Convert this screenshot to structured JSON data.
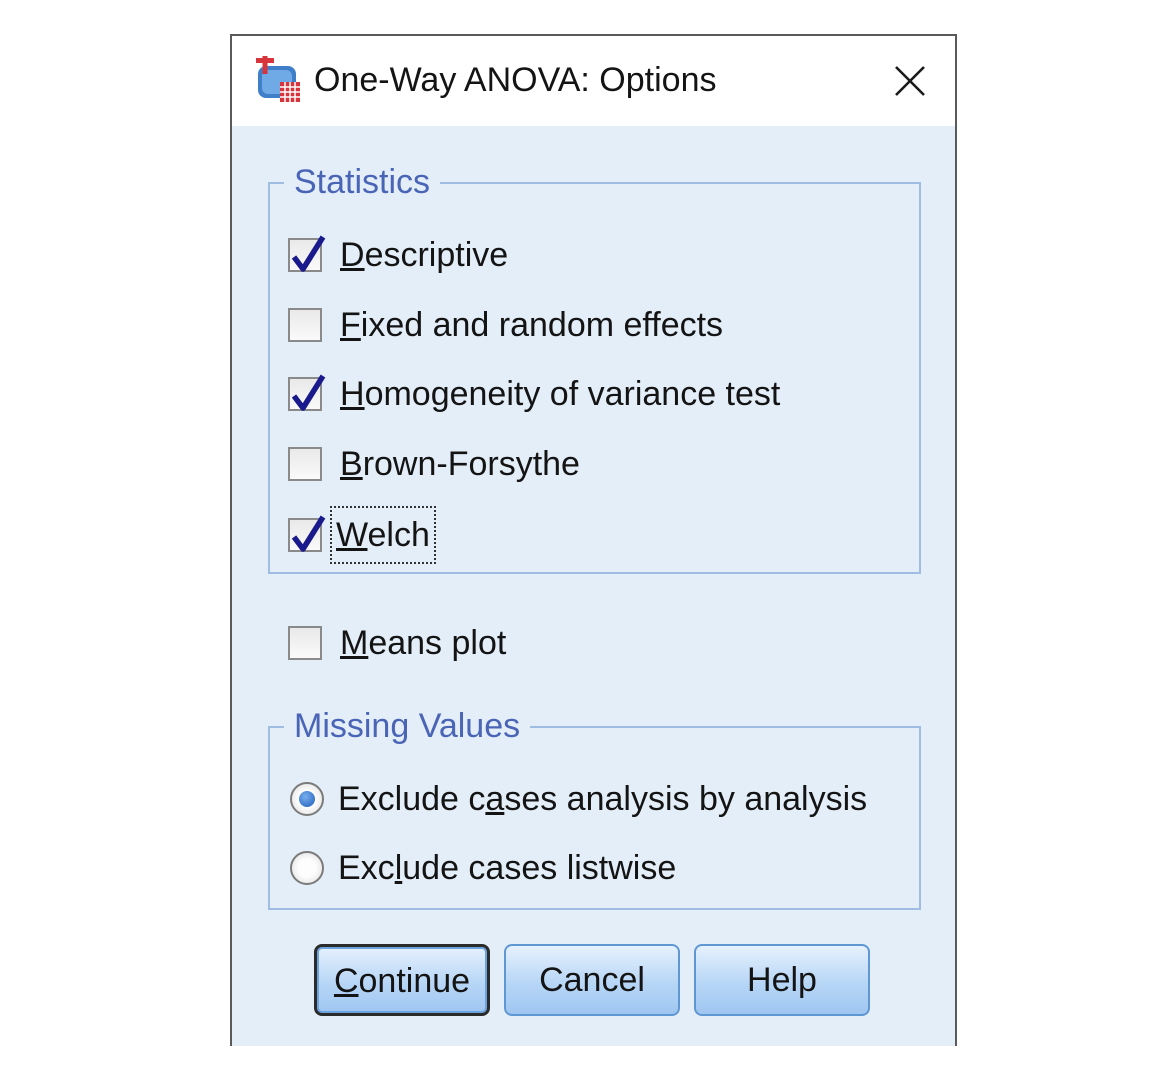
{
  "dialog": {
    "title": "One-Way ANOVA: Options",
    "icons": {
      "app": "spss-dialog-icon",
      "close": "close-icon"
    }
  },
  "statistics": {
    "legend": "Statistics",
    "items": [
      {
        "pre": "",
        "key": "D",
        "post": "escriptive",
        "checked": true
      },
      {
        "pre": "",
        "key": "F",
        "post": "ixed and random effects",
        "checked": false
      },
      {
        "pre": "",
        "key": "H",
        "post": "omogeneity of variance test",
        "checked": true
      },
      {
        "pre": "",
        "key": "B",
        "post": "rown-Forsythe",
        "checked": false
      },
      {
        "pre": "",
        "key": "W",
        "post": "elch",
        "checked": true
      }
    ]
  },
  "means_plot": {
    "pre": "",
    "key": "M",
    "post": "eans plot",
    "checked": false
  },
  "missing_values": {
    "legend": "Missing Values",
    "options": [
      {
        "pre": "Exclude c",
        "key": "a",
        "post": "ses analysis by analysis",
        "selected": true
      },
      {
        "pre": "Exc",
        "key": "l",
        "post": "ude cases listwise",
        "selected": false
      }
    ]
  },
  "buttons": {
    "continue": {
      "key": "C",
      "post": "ontinue"
    },
    "cancel": "Cancel",
    "help": "Help"
  },
  "colors": {
    "dialog_bg": "#e3eef9",
    "group_border": "#9fbde0",
    "legend_text": "#4a64b6",
    "check_mark": "#1a1a8c",
    "button_border": "#5f97d3"
  }
}
